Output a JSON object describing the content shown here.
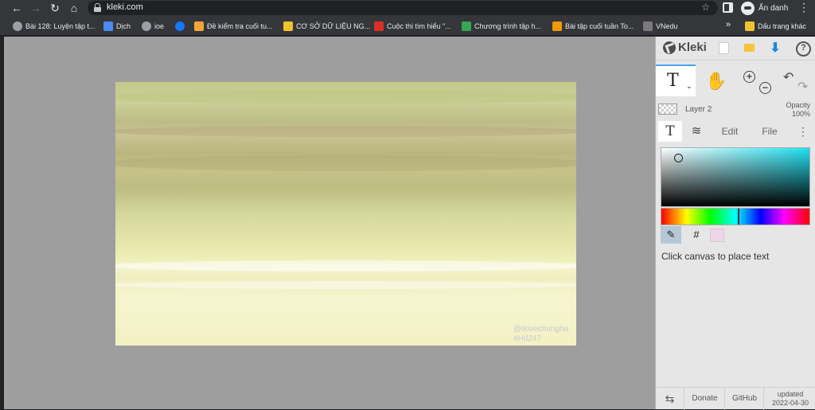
{
  "browser": {
    "url": "kleki.com",
    "profile_name": "Ẩn danh",
    "icons": [
      "back-icon",
      "forward-icon",
      "reload-icon",
      "home-icon",
      "lock-icon",
      "star-icon",
      "menu-dots-icon"
    ],
    "bookmarks": [
      {
        "label": "Bài 128: Luyện tập t...",
        "color": "#9aa0a6"
      },
      {
        "label": "Dịch",
        "color": "#4c8bf5"
      },
      {
        "label": "ioe",
        "color": "#9aa0a6"
      },
      {
        "label": "",
        "color": "#1877f2"
      },
      {
        "label": "Đề kiểm tra cuối tu...",
        "color": "#f4a43a"
      },
      {
        "label": "CƠ SỞ DỮ LIỆU NG...",
        "color": "#f2c230"
      },
      {
        "label": "Cuộc thi tìm hiểu \"...",
        "color": "#d93025"
      },
      {
        "label": "Chương trình tập h...",
        "color": "#34a853"
      },
      {
        "label": "Bài tập cuối tuần To...",
        "color": "#f29900"
      },
      {
        "label": "VNedu",
        "color": "#7a7a7a"
      }
    ],
    "bookmarks_more": "»",
    "other_bookmarks": "Dấu trang khác"
  },
  "canvas": {
    "watermark_line1": "@ilovechungha",
    "watermark_line2": "#Hd247"
  },
  "kleki": {
    "logo": "Kleki",
    "layer_name": "Layer 2",
    "opacity_label": "Opacity",
    "opacity_value": "100%",
    "tabs": {
      "edit": "Edit",
      "file": "File"
    },
    "hex_label": "#",
    "hint": "Click canvas to place text",
    "footer": {
      "donate": "Donate",
      "github": "GitHub",
      "updated_label": "updated",
      "updated_date": "2022-04-30"
    },
    "colors": {
      "accent": "#4aa3f0",
      "swatch": "#f0d5ea",
      "download": "#1f88d9"
    }
  }
}
